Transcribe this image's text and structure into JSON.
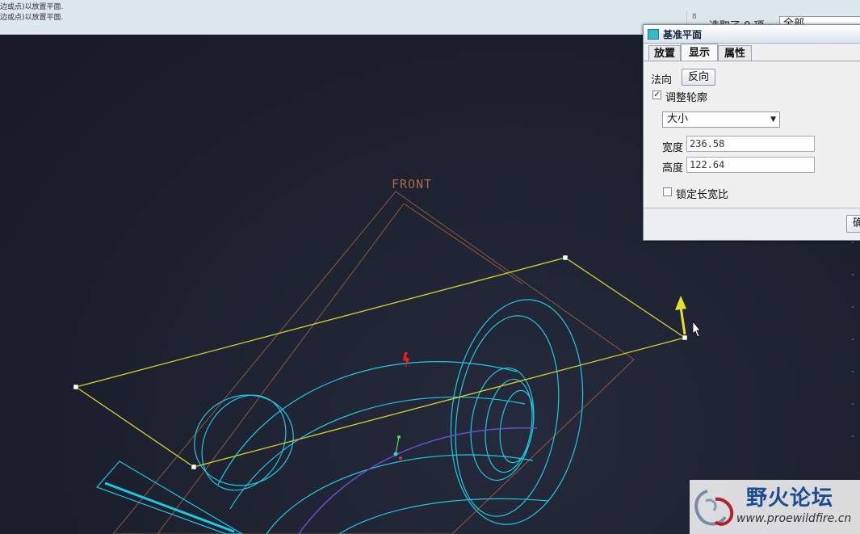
{
  "message_bar": {
    "line1": "边或点)以放置平面.",
    "line2": "边或点)以放置平面."
  },
  "status": {
    "selection_num": "8",
    "selection_text": "选取了 0 项",
    "filter_value": "全部"
  },
  "model": {
    "datum_label": "FRONT",
    "colors": {
      "plane_outline": "#d8d02a",
      "datum_plane": "#8a5a40",
      "part_edges": "#1ec8e0",
      "curve": "#6a50c8",
      "arrow": "#e8e030",
      "marker": "#e82020"
    }
  },
  "dialog": {
    "title": "基准平面",
    "tabs": [
      {
        "label": "放置",
        "active": false
      },
      {
        "label": "显示",
        "active": true
      },
      {
        "label": "属性",
        "active": false
      }
    ],
    "normal_label": "法向",
    "flip_button": "反向",
    "adjust_outline": {
      "label": "调整轮廓",
      "checked": true
    },
    "size_mode": "大小",
    "width": {
      "label": "宽度",
      "value": "236.58"
    },
    "height": {
      "label": "高度",
      "value": "122.64"
    },
    "lock_ratio": {
      "label": "锁定长宽比",
      "checked": false
    },
    "ok_button": "确定"
  },
  "watermark": {
    "title": "野火论坛",
    "url": "www.proewildfire.cn"
  }
}
